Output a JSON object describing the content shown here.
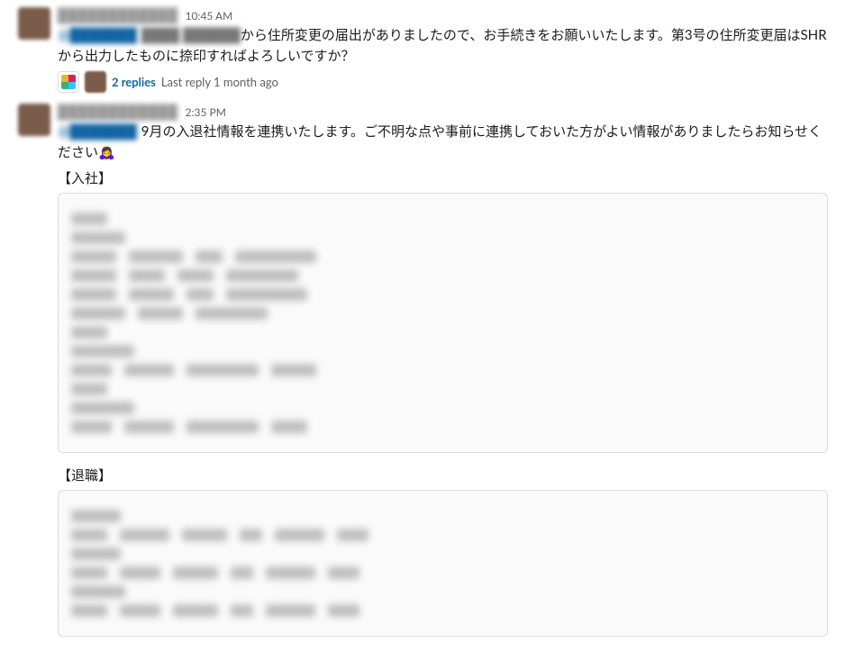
{
  "messages": [
    {
      "username": "████████████",
      "timestamp": "10:45 AM",
      "mention": "@███████",
      "blurred_prefix": "████ ██████",
      "text_after": "から住所変更の届出がありましたので、お手続きをお願いいたします。第3号の住所変更届はSHRから出力したものに捺印すればよろしいですか？",
      "thread": {
        "replies_label": "2 replies",
        "last_reply": "Last reply 1 month ago"
      }
    },
    {
      "username": "████████████",
      "timestamp": "2:35 PM",
      "mention": "@███████",
      "text_after": " 9月の入退社情報を連携いたします。ご不明な点や事前に連携しておいた方がよい情報がありましたらお知らせください",
      "emoji": "🙇‍♀️",
      "section1": "【入社】",
      "section2": "【退職】"
    }
  ]
}
